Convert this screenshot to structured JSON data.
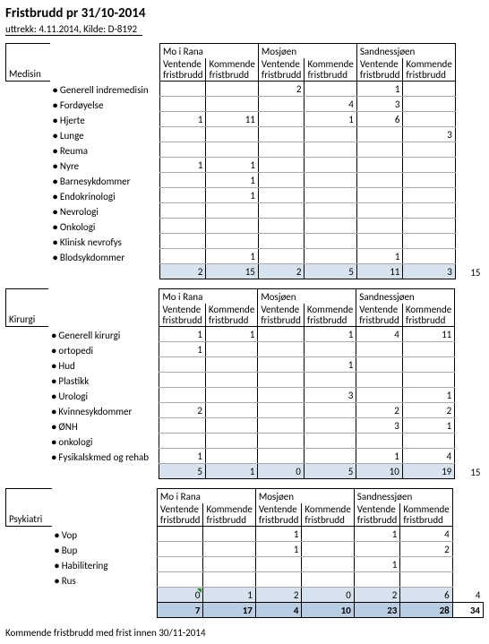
{
  "title": "Fristbrudd pr 31/10-2014",
  "subtitle": "uttrekk: 4.11.2014, Kilde: D-8192",
  "regions": [
    "Mo i Rana",
    "Mosjøen",
    "Sandnessjøen"
  ],
  "col_sub": [
    "Ventende fristbrudd",
    "Kommende fristbrudd"
  ],
  "sections": [
    {
      "name": "Medisin",
      "rows": [
        {
          "label": "Generell indremedisin",
          "v": [
            "",
            "",
            "2",
            "",
            "1",
            ""
          ]
        },
        {
          "label": "Fordøyelse",
          "v": [
            "",
            "",
            "",
            "4",
            "3",
            ""
          ]
        },
        {
          "label": "Hjerte",
          "v": [
            "1",
            "11",
            "",
            "1",
            "6",
            ""
          ]
        },
        {
          "label": "Lunge",
          "v": [
            "",
            "",
            "",
            "",
            "",
            "3"
          ]
        },
        {
          "label": "Reuma",
          "v": [
            "",
            "",
            "",
            "",
            "",
            ""
          ]
        },
        {
          "label": "Nyre",
          "v": [
            "1",
            "1",
            "",
            "",
            "",
            ""
          ]
        },
        {
          "label": "Barnesykdommer",
          "v": [
            "",
            "1",
            "",
            "",
            "",
            ""
          ]
        },
        {
          "label": "Endokrinologi",
          "v": [
            "",
            "1",
            "",
            "",
            "",
            ""
          ]
        },
        {
          "label": "Nevrologi",
          "v": [
            "",
            "",
            "",
            "",
            "",
            ""
          ]
        },
        {
          "label": "Onkologi",
          "v": [
            "",
            "",
            "",
            "",
            "",
            ""
          ]
        },
        {
          "label": "Klinisk nevrofys",
          "v": [
            "",
            "",
            "",
            "",
            "",
            ""
          ]
        },
        {
          "label": "Blodsykdommer",
          "v": [
            "",
            "1",
            "",
            "",
            "1",
            ""
          ]
        }
      ],
      "subtotal": [
        "2",
        "15",
        "2",
        "5",
        "11",
        "3"
      ],
      "outside": "15"
    },
    {
      "name": "Kirurgi",
      "rows": [
        {
          "label": "Generell kirurgi",
          "v": [
            "1",
            "1",
            "",
            "1",
            "4",
            "11"
          ]
        },
        {
          "label": "ortopedi",
          "v": [
            "1",
            "",
            "",
            "",
            "",
            ""
          ]
        },
        {
          "label": "Hud",
          "v": [
            "",
            "",
            "",
            "1",
            "",
            ""
          ]
        },
        {
          "label": "Plastikk",
          "v": [
            "",
            "",
            "",
            "",
            "",
            ""
          ]
        },
        {
          "label": "Urologi",
          "v": [
            "",
            "",
            "",
            "3",
            "",
            "1"
          ]
        },
        {
          "label": "Kvinnesykdommer",
          "v": [
            "2",
            "",
            "",
            "",
            "2",
            "2"
          ]
        },
        {
          "label": "ØNH",
          "v": [
            "",
            "",
            "",
            "",
            "3",
            "1"
          ]
        },
        {
          "label": "onkologi",
          "v": [
            "",
            "",
            "",
            "",
            "",
            ""
          ]
        },
        {
          "label": "Fysikalskmed og rehab",
          "v": [
            "1",
            "",
            "",
            "",
            "1",
            "4"
          ]
        }
      ],
      "subtotal": [
        "5",
        "1",
        "0",
        "5",
        "10",
        "19"
      ],
      "outside": "15"
    },
    {
      "name": "Psykiatri",
      "rows": [
        {
          "label": "Vop",
          "v": [
            "",
            "",
            "1",
            "",
            "1",
            "4"
          ]
        },
        {
          "label": "Bup",
          "v": [
            "",
            "",
            "1",
            "",
            "",
            "2"
          ]
        },
        {
          "label": "Habilitering",
          "v": [
            "",
            "",
            "",
            "",
            "1",
            ""
          ]
        },
        {
          "label": "Rus",
          "v": [
            "",
            "",
            "",
            "",
            "",
            ""
          ]
        }
      ],
      "subtotal": [
        "0",
        "1",
        "2",
        "0",
        "2",
        "6"
      ],
      "outside": "4",
      "tri_cols": [
        0
      ]
    }
  ],
  "grand": [
    "7",
    "17",
    "4",
    "10",
    "23",
    "28"
  ],
  "grand_outside": "34",
  "footnote": "Kommende fristbrudd med frist innen 30/11-2014",
  "chart_data": {
    "type": "table",
    "title": "Fristbrudd pr 31/10-2014",
    "regions": [
      "Mo i Rana",
      "Mosjøen",
      "Sandnessjøen"
    ],
    "measures": [
      "Ventende fristbrudd",
      "Kommende fristbrudd"
    ],
    "sections": {
      "Medisin": {
        "Generell indremedisin": [
          null,
          null,
          2,
          null,
          1,
          null
        ],
        "Fordøyelse": [
          null,
          null,
          null,
          4,
          3,
          null
        ],
        "Hjerte": [
          1,
          11,
          null,
          1,
          6,
          null
        ],
        "Lunge": [
          null,
          null,
          null,
          null,
          null,
          3
        ],
        "Reuma": [
          null,
          null,
          null,
          null,
          null,
          null
        ],
        "Nyre": [
          1,
          1,
          null,
          null,
          null,
          null
        ],
        "Barnesykdommer": [
          null,
          1,
          null,
          null,
          null,
          null
        ],
        "Endokrinologi": [
          null,
          1,
          null,
          null,
          null,
          null
        ],
        "Nevrologi": [
          null,
          null,
          null,
          null,
          null,
          null
        ],
        "Onkologi": [
          null,
          null,
          null,
          null,
          null,
          null
        ],
        "Klinisk nevrofys": [
          null,
          null,
          null,
          null,
          null,
          null
        ],
        "Blodsykdommer": [
          null,
          1,
          null,
          null,
          1,
          null
        ],
        "subtotal": [
          2,
          15,
          2,
          5,
          11,
          3
        ],
        "row_total": 15
      },
      "Kirurgi": {
        "Generell kirurgi": [
          1,
          1,
          null,
          1,
          4,
          11
        ],
        "ortopedi": [
          1,
          null,
          null,
          null,
          null,
          null
        ],
        "Hud": [
          null,
          null,
          null,
          1,
          null,
          null
        ],
        "Plastikk": [
          null,
          null,
          null,
          null,
          null,
          null
        ],
        "Urologi": [
          null,
          null,
          null,
          3,
          null,
          1
        ],
        "Kvinnesykdommer": [
          2,
          null,
          null,
          null,
          2,
          2
        ],
        "ØNH": [
          null,
          null,
          null,
          null,
          3,
          1
        ],
        "onkologi": [
          null,
          null,
          null,
          null,
          null,
          null
        ],
        "Fysikalskmed og rehab": [
          1,
          null,
          null,
          null,
          1,
          4
        ],
        "subtotal": [
          5,
          1,
          0,
          5,
          10,
          19
        ],
        "row_total": 15
      },
      "Psykiatri": {
        "Vop": [
          null,
          null,
          1,
          null,
          1,
          4
        ],
        "Bup": [
          null,
          null,
          1,
          null,
          null,
          2
        ],
        "Habilitering": [
          null,
          null,
          null,
          null,
          1,
          null
        ],
        "Rus": [
          null,
          null,
          null,
          null,
          null,
          null
        ],
        "subtotal": [
          0,
          1,
          2,
          0,
          2,
          6
        ],
        "row_total": 4
      }
    },
    "grand_total": [
      7,
      17,
      4,
      10,
      23,
      28
    ],
    "grand_row_total": 34
  }
}
